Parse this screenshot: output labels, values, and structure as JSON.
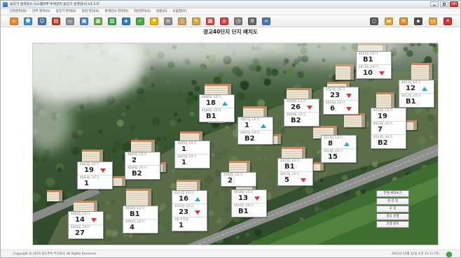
{
  "window": {
    "title": "승강기 원격감시 시스템(HP 주택관리 승강기 원격감시) v1.1.0"
  },
  "menu": [
    "단지관리(D)",
    "단지 위치(G)",
    "승강기 관리(E)",
    "점검 관리(S)",
    "원격감시 관리(R)",
    "자산관리(A)",
    "설정(O)",
    "도움말(H)"
  ],
  "toolbar": {
    "left": [
      {
        "icon": "home-icon",
        "color": "#e8892b"
      },
      {
        "icon": "user-group-icon",
        "color": "#3d8fd1"
      },
      {
        "icon": "user-key-icon",
        "color": "#4a6fa5"
      },
      {
        "icon": "book-icon",
        "color": "#c0392b"
      },
      {
        "icon": "document-icon",
        "color": "#8a8f98"
      },
      {
        "icon": "monitor-icon",
        "color": "#4b87c5"
      },
      {
        "icon": "table-icon",
        "color": "#6aa84f"
      },
      {
        "icon": "chart-icon",
        "color": "#3ea34a"
      },
      {
        "icon": "network-icon",
        "color": "#2f77c2"
      },
      {
        "icon": "check-icon",
        "color": "#49a942"
      },
      {
        "icon": "flag-icon",
        "color": "#f0b400"
      },
      {
        "icon": "report-icon",
        "color": "#8e8e8e"
      },
      {
        "icon": "clipboard-icon",
        "color": "#c8a060"
      },
      {
        "icon": "notepad-icon",
        "color": "#d9a441"
      },
      {
        "icon": "calendar-icon",
        "color": "#d24b3a"
      },
      {
        "icon": "target-icon",
        "color": "#d23c3c"
      },
      {
        "icon": "clock-icon",
        "color": "#7d7d7d"
      },
      {
        "icon": "settings-icon",
        "color": "#666666"
      },
      {
        "icon": "bicycle-icon",
        "color": "#4a76b8"
      }
    ],
    "right": [
      {
        "icon": "search-icon",
        "color": "#5a5a5a"
      },
      {
        "icon": "folder-icon",
        "color": "#e6a532"
      },
      {
        "icon": "mail-icon",
        "color": "#e08a2b"
      },
      {
        "icon": "archive-icon",
        "color": "#4f4f4f"
      },
      {
        "icon": "open-folder-icon",
        "color": "#d9a13a"
      },
      {
        "icon": "exit-icon",
        "color": "#d23030"
      }
    ]
  },
  "page_title": "광교40단지 단지 배치도",
  "colors": {
    "arrow_up": "#2ea6c8",
    "arrow_down": "#d8353b"
  },
  "units": [
    {
      "rows": [
        {
          "caption": "4011동 1호기",
          "value": "B1"
        },
        {
          "caption": "4011동 2호기",
          "value": "10",
          "arrow": "down"
        }
      ]
    },
    {
      "rows": [
        {
          "caption": "4012동 1호기",
          "value": "12",
          "arrow": "up"
        },
        {
          "caption": "4012동 2호기",
          "value": "B1"
        }
      ]
    },
    {
      "rows": [
        {
          "caption": "4010동 1호기",
          "value": "23",
          "arrow": "down"
        },
        {
          "caption": "4010동 2호기",
          "value": "6",
          "arrow": "down"
        }
      ]
    },
    {
      "rows": [
        {
          "caption": "4013동 1호기",
          "value": "19"
        },
        {
          "caption": "4013동 2호기",
          "value": "7"
        },
        {
          "caption": "4013동 3호기",
          "value": "B2"
        }
      ]
    },
    {
      "rows": [
        {
          "caption": "4009동 1호기",
          "value": "26",
          "arrow": "down"
        },
        {
          "caption": "4009동 2호기",
          "value": "B2"
        }
      ]
    },
    {
      "rows": [
        {
          "caption": "4014동 1호기",
          "value": "8",
          "arrow": "up"
        },
        {
          "caption": "4014동 2호기",
          "value": "15"
        }
      ]
    },
    {
      "rows": [
        {
          "caption": "4006동 1호기",
          "value": "18",
          "arrow": "up"
        },
        {
          "caption": "4006동 2호기",
          "value": "B1"
        }
      ]
    },
    {
      "rows": [
        {
          "caption": "4007동 1호기",
          "value": "1",
          "arrow": "up"
        },
        {
          "caption": "4007동 2호기",
          "value": "B2"
        }
      ]
    },
    {
      "rows": [
        {
          "caption": "4005동 1호기",
          "value": "1"
        },
        {
          "caption": "4005동 2호기",
          "value": "1"
        }
      ]
    },
    {
      "rows": [
        {
          "caption": "4004동 1호기",
          "value": "2"
        },
        {
          "caption": "4004동 2호기",
          "value": "B2"
        }
      ]
    },
    {
      "rows": [
        {
          "caption": "4003동 1호기",
          "value": "19",
          "arrow": "down"
        },
        {
          "caption": "4003동 2호기",
          "value": "1"
        }
      ]
    },
    {
      "rows": [
        {
          "caption": "4015동 1호기",
          "value": "B1"
        },
        {
          "caption": "4015동 2호기",
          "value": "5",
          "arrow": "down"
        }
      ]
    },
    {
      "rows": [
        {
          "caption": "4008동 1호기",
          "value": "2"
        }
      ]
    },
    {
      "rows": [
        {
          "caption": "4016동 1호기",
          "value": "13",
          "arrow": "down"
        },
        {
          "caption": "4016동 2호기",
          "value": "B1"
        }
      ]
    },
    {
      "rows": [
        {
          "caption": "4017동 1호기",
          "value": "16",
          "arrow": "up"
        },
        {
          "caption": "4017동 2호기",
          "value": "23",
          "arrow": "down"
        },
        {
          "caption": "3층 주차장",
          "value": "1"
        }
      ]
    },
    {
      "rows": [
        {
          "caption": "4002동 1호기",
          "value": "B1"
        },
        {
          "caption": "4002동 2호기",
          "value": "4"
        }
      ]
    },
    {
      "rows": [
        {
          "caption": "4001동 1호기",
          "value": "14",
          "arrow": "down"
        },
        {
          "caption": "4001동 2호기",
          "value": "27"
        }
      ]
    }
  ],
  "legend": [
    "전체 세대보기",
    "점 검 중",
    "고 장",
    "정상 운행",
    "운행 정지"
  ],
  "status": {
    "copyright": "Copyright © 2015 광교주택 주식회사. All Rights Reserved.",
    "datetime": "2015년 11월 12일 오전 11:11 (목)"
  }
}
